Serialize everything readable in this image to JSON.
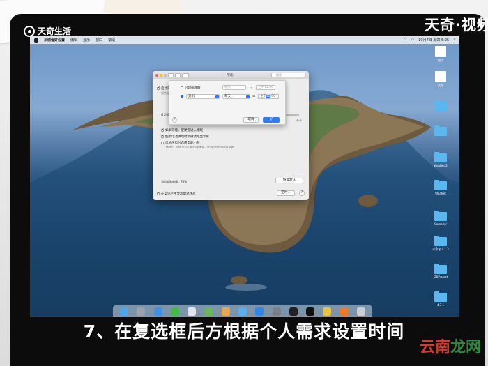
{
  "watermark_left": "天奇生活",
  "watermark_right": "天奇·视频",
  "menubar": {
    "app": "系统偏好设置",
    "items": [
      "编辑",
      "显示",
      "窗口",
      "帮助"
    ],
    "clock": "10月7日 周四 5:25"
  },
  "prefs_window": {
    "title": "节能",
    "search_placeholder": "搜索",
    "opt_auto_switch": "启动或唤醒",
    "opt_auto_switch_sub": "您的电脑将在...",
    "slider_label": "此时间段后",
    "slider_end": "永不",
    "checkbox_1": "如果可能，使硬盘进入睡眠",
    "checkbox_2": "使用电池供电时稍微调暗显示屏",
    "checkbox_3": "电池供电时启用电能小憩",
    "checkbox_3_desc": "睡眠时，Mac 可以定期检查新邮件、日历和其他 iCloud 更新",
    "battery_status": "当前电池电量：78%",
    "restore_button": "恢复默认",
    "show_battery_menu": "在菜单栏中显示电池状态",
    "schedule_button": "定时...",
    "help": "?"
  },
  "schedule_sheet": {
    "row1_label": "启动或唤醒",
    "row1_day": "每天",
    "row1_time_prefix": "于",
    "row1_time": "上午12:00",
    "row2_action": "关机",
    "row2_day": "每天",
    "row2_time_prefix": "于",
    "row2_time_a": "上午",
    "row2_time_b": "12",
    "row2_time_c": ":00",
    "cancel": "取消",
    "ok": "好",
    "help": "?"
  },
  "desktop_icons": [
    {
      "label": "图片",
      "kind": "doc"
    },
    {
      "label": "文档",
      "kind": "doc"
    },
    {
      "label": "",
      "kind": "folder"
    },
    {
      "label": "",
      "kind": "folder"
    },
    {
      "label": "WeaNet 2",
      "kind": "folder"
    },
    {
      "label": "WeaNet",
      "kind": "folder"
    },
    {
      "label": "Compiler",
      "kind": "folder"
    },
    {
      "label": "未命名 4.1.3",
      "kind": "folder"
    },
    {
      "label": "JZBProject",
      "kind": "folder"
    },
    {
      "label": "4.3.1",
      "kind": "folder"
    }
  ],
  "subtitle": "7、在复选框后方根据个人需求设置时间",
  "brand": {
    "a": "云南",
    "b": "龙网"
  },
  "colors": {
    "accent": "#2f7cf6",
    "folder": "#5bb7ef",
    "brand_red": "#d43b2c",
    "brand_green": "#2d8d3a"
  }
}
